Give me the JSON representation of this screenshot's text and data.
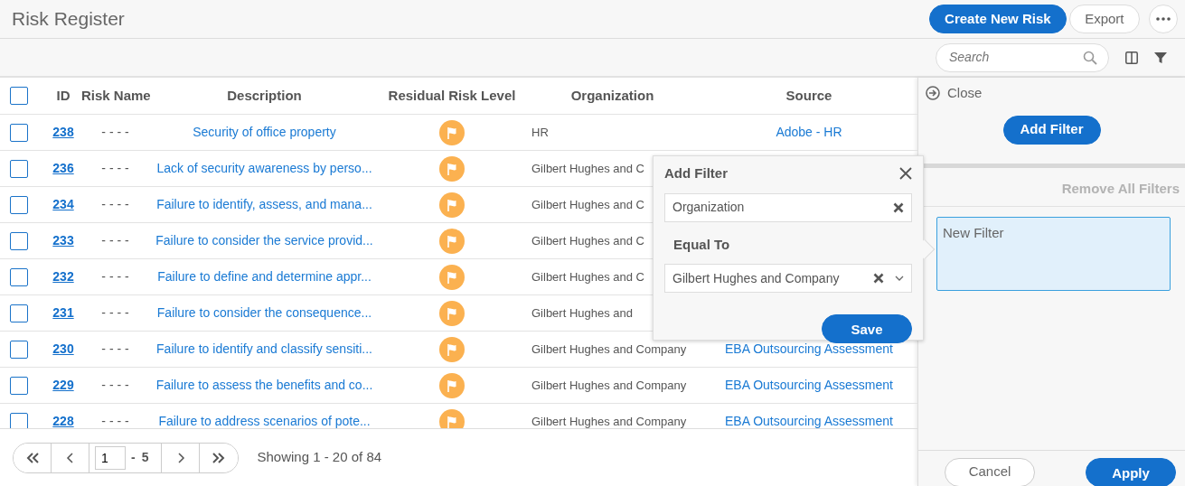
{
  "header": {
    "title": "Risk Register",
    "create_button": "Create New Risk",
    "export_button": "Export"
  },
  "toolbar": {
    "search": {
      "placeholder": "Search"
    }
  },
  "table": {
    "select_all_checked": false,
    "columns": [
      "ID",
      "Risk Name",
      "Description",
      "Residual Risk Level",
      "Organization",
      "Source"
    ],
    "rows": [
      {
        "checked": false,
        "id": "238",
        "risk_name": "- - - -",
        "description": "Security of office property",
        "organization": "HR",
        "source": "Adobe - HR"
      },
      {
        "checked": false,
        "id": "236",
        "risk_name": "- - - -",
        "description": "Lack of security awareness by perso...",
        "organization": "Gilbert Hughes and C"
      },
      {
        "checked": false,
        "id": "234",
        "risk_name": "- - - -",
        "description": "Failure to identify, assess, and mana...",
        "organization": "Gilbert Hughes and C"
      },
      {
        "checked": false,
        "id": "233",
        "risk_name": "- - - -",
        "description": "Failure to consider the service provid...",
        "organization": "Gilbert Hughes and C"
      },
      {
        "checked": false,
        "id": "232",
        "risk_name": "- - - -",
        "description": "Failure to define and determine appr...",
        "organization": "Gilbert Hughes and C"
      },
      {
        "checked": false,
        "id": "231",
        "risk_name": "- - - -",
        "description": "Failure to consider the consequence...",
        "organization": "Gilbert Hughes and"
      },
      {
        "checked": false,
        "id": "230",
        "risk_name": "- - - -",
        "description": "Failure to identify and classify sensiti...",
        "organization": "Gilbert Hughes and Company",
        "source": "EBA Outsourcing Assessment"
      },
      {
        "checked": false,
        "id": "229",
        "risk_name": "- - - -",
        "description": "Failure to assess the benefits and co...",
        "organization": "Gilbert Hughes and Company",
        "source": "EBA Outsourcing Assessment"
      },
      {
        "checked": false,
        "id": "228",
        "risk_name": "- - - -",
        "description": "Failure to address scenarios of pote...",
        "organization": "Gilbert Hughes and Company",
        "source": "EBA Outsourcing Assessment"
      }
    ]
  },
  "pagination": {
    "page": "1",
    "separator": "-",
    "total_pages": "5",
    "showing": "Showing 1 - 20 of 84"
  },
  "filter_panel": {
    "close": "Close",
    "add_filter": "Add Filter",
    "remove_all": "Remove All Filters",
    "filters": [
      {
        "label": "New Filter",
        "selected": true
      }
    ],
    "cancel": "Cancel",
    "apply": "Apply"
  },
  "add_filter_popup": {
    "title": "Add Filter",
    "field": "Organization",
    "condition": "Equal To",
    "value": "Gilbert Hughes and Company",
    "save": "Save"
  }
}
